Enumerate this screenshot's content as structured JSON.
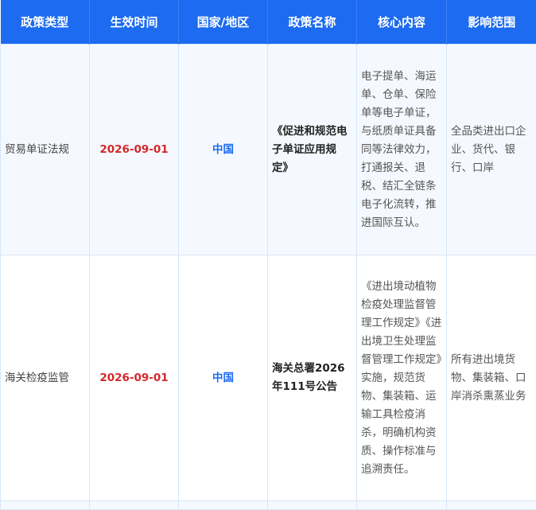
{
  "headers": [
    "政策类型",
    "生效时间",
    "国家/地区",
    "政策名称",
    "核心内容",
    "影响范围"
  ],
  "rows": [
    {
      "type": "贸易单证法规",
      "date": "2026-09-01",
      "country": "中国",
      "name": "《促进和规范电子单证应用规定》",
      "core": "电子提单、海运单、仓单、保险单等电子单证，与纸质单证具备同等法律效力，打通报关、退税、结汇全链条电子化流转，推进国际互认。",
      "scope": "全品类进出口企业、货代、银行、口岸"
    },
    {
      "type": "海关检疫监管",
      "date": "2026-09-01",
      "country": "中国",
      "name": "海关总署2026年111号公告",
      "core": "《进出境动植物检疫处理监督管理工作规定》《进出境卫生处理监督管理工作规定》实施，规范货物、集装箱、运输工具检疫消杀，明确机构资质、操作标准与追溯责任。",
      "scope": "所有进出境货物、集装箱、口岸消杀熏蒸业务"
    }
  ]
}
